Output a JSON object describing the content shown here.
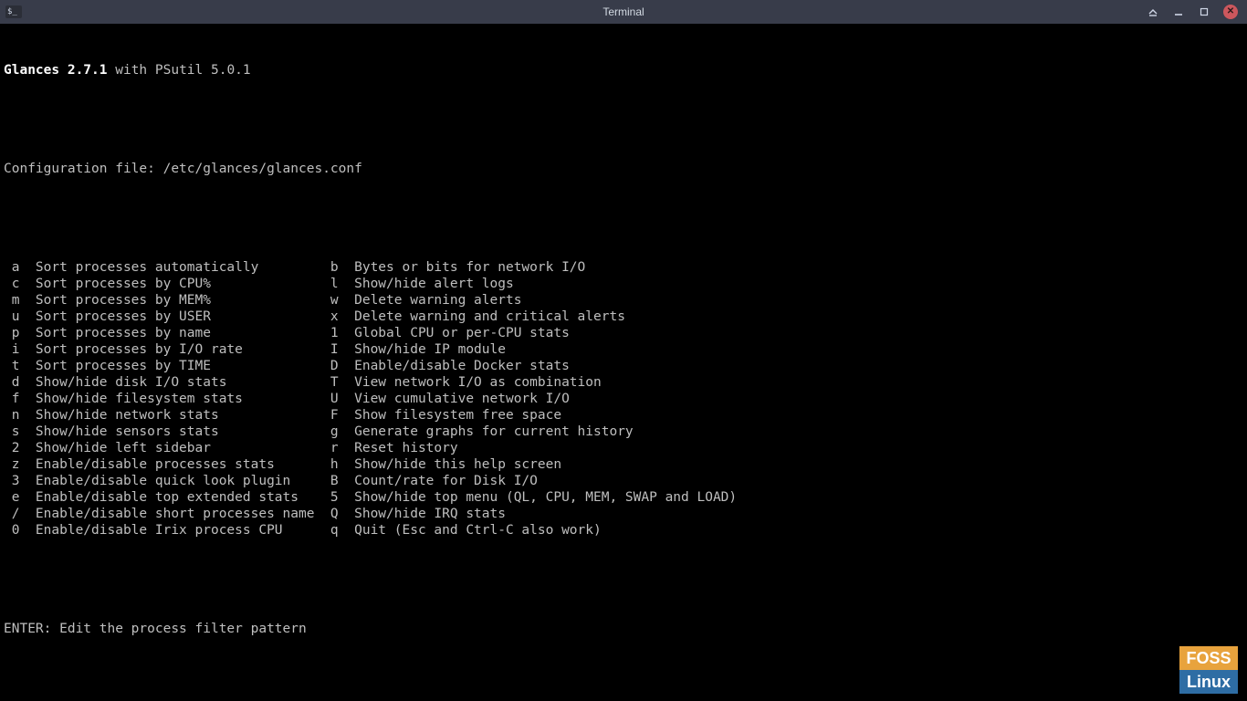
{
  "window": {
    "title": "Terminal",
    "app_icon_glyph": "$_"
  },
  "header": {
    "app_name": "Glances",
    "version": "2.7.1",
    "with": " with PSutil 5.0.1"
  },
  "config_line": "Configuration file: /etc/glances/glances.conf",
  "help_rows": [
    {
      "k1": "a",
      "d1": "Sort processes automatically",
      "k2": "b",
      "d2": "Bytes or bits for network I/O"
    },
    {
      "k1": "c",
      "d1": "Sort processes by CPU%",
      "k2": "l",
      "d2": "Show/hide alert logs"
    },
    {
      "k1": "m",
      "d1": "Sort processes by MEM%",
      "k2": "w",
      "d2": "Delete warning alerts"
    },
    {
      "k1": "u",
      "d1": "Sort processes by USER",
      "k2": "x",
      "d2": "Delete warning and critical alerts"
    },
    {
      "k1": "p",
      "d1": "Sort processes by name",
      "k2": "1",
      "d2": "Global CPU or per-CPU stats"
    },
    {
      "k1": "i",
      "d1": "Sort processes by I/O rate",
      "k2": "I",
      "d2": "Show/hide IP module"
    },
    {
      "k1": "t",
      "d1": "Sort processes by TIME",
      "k2": "D",
      "d2": "Enable/disable Docker stats"
    },
    {
      "k1": "d",
      "d1": "Show/hide disk I/O stats",
      "k2": "T",
      "d2": "View network I/O as combination"
    },
    {
      "k1": "f",
      "d1": "Show/hide filesystem stats",
      "k2": "U",
      "d2": "View cumulative network I/O"
    },
    {
      "k1": "n",
      "d1": "Show/hide network stats",
      "k2": "F",
      "d2": "Show filesystem free space"
    },
    {
      "k1": "s",
      "d1": "Show/hide sensors stats",
      "k2": "g",
      "d2": "Generate graphs for current history"
    },
    {
      "k1": "2",
      "d1": "Show/hide left sidebar",
      "k2": "r",
      "d2": "Reset history"
    },
    {
      "k1": "z",
      "d1": "Enable/disable processes stats",
      "k2": "h",
      "d2": "Show/hide this help screen"
    },
    {
      "k1": "3",
      "d1": "Enable/disable quick look plugin",
      "k2": "B",
      "d2": "Count/rate for Disk I/O"
    },
    {
      "k1": "e",
      "d1": "Enable/disable top extended stats",
      "k2": "5",
      "d2": "Show/hide top menu (QL, CPU, MEM, SWAP and LOAD)"
    },
    {
      "k1": "/",
      "d1": "Enable/disable short processes name",
      "k2": "Q",
      "d2": "Show/hide IRQ stats"
    },
    {
      "k1": "0",
      "d1": "Enable/disable Irix process CPU",
      "k2": "q",
      "d2": "Quit (Esc and Ctrl-C also work)"
    }
  ],
  "footer": "ENTER: Edit the process filter pattern",
  "watermark": {
    "top": "FOSS",
    "bot": "Linux"
  }
}
